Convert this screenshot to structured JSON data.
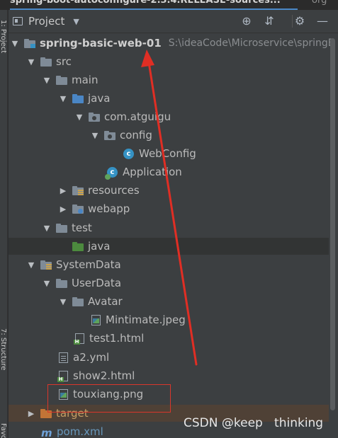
{
  "editor_tabs": {
    "active": "spring-boot-autoconfigure-2.3.4.RELEASE-sources...",
    "other": "org"
  },
  "left_stripe": {
    "project_label": "1: Project",
    "structure_label": "7: Structure",
    "favorites_label": "Favorites"
  },
  "header": {
    "title": "Project",
    "icons": [
      "project-icon",
      "chevron-down-icon",
      "target-icon",
      "collapse-all-icon",
      "gear-icon",
      "hide-icon"
    ]
  },
  "tree": {
    "root": {
      "name": "spring-basic-web-01",
      "path": "S:\\ideaCode\\Microservice\\springB"
    },
    "src": "src",
    "main": "main",
    "java": "java",
    "package": "com.atguigu",
    "config": "config",
    "webconfig": "WebConfig",
    "application": "Application",
    "resources": "resources",
    "webapp": "webapp",
    "test": "test",
    "test_java": "java",
    "systemdata": "SystemData",
    "userdata": "UserData",
    "avatar": "Avatar",
    "mintimate": "Mintimate.jpeg",
    "test1": "test1.html",
    "a2": "a2.yml",
    "show2": "show2.html",
    "touxiang": "touxiang.png",
    "target": "target",
    "pom": "pom.xml"
  },
  "colors": {
    "annotation": "#d9362b",
    "selection": "#4f4136",
    "folder_blue": "#4a86c5",
    "folder_green": "#4c8a3e"
  },
  "watermark": "CSDN @keep   thinking"
}
